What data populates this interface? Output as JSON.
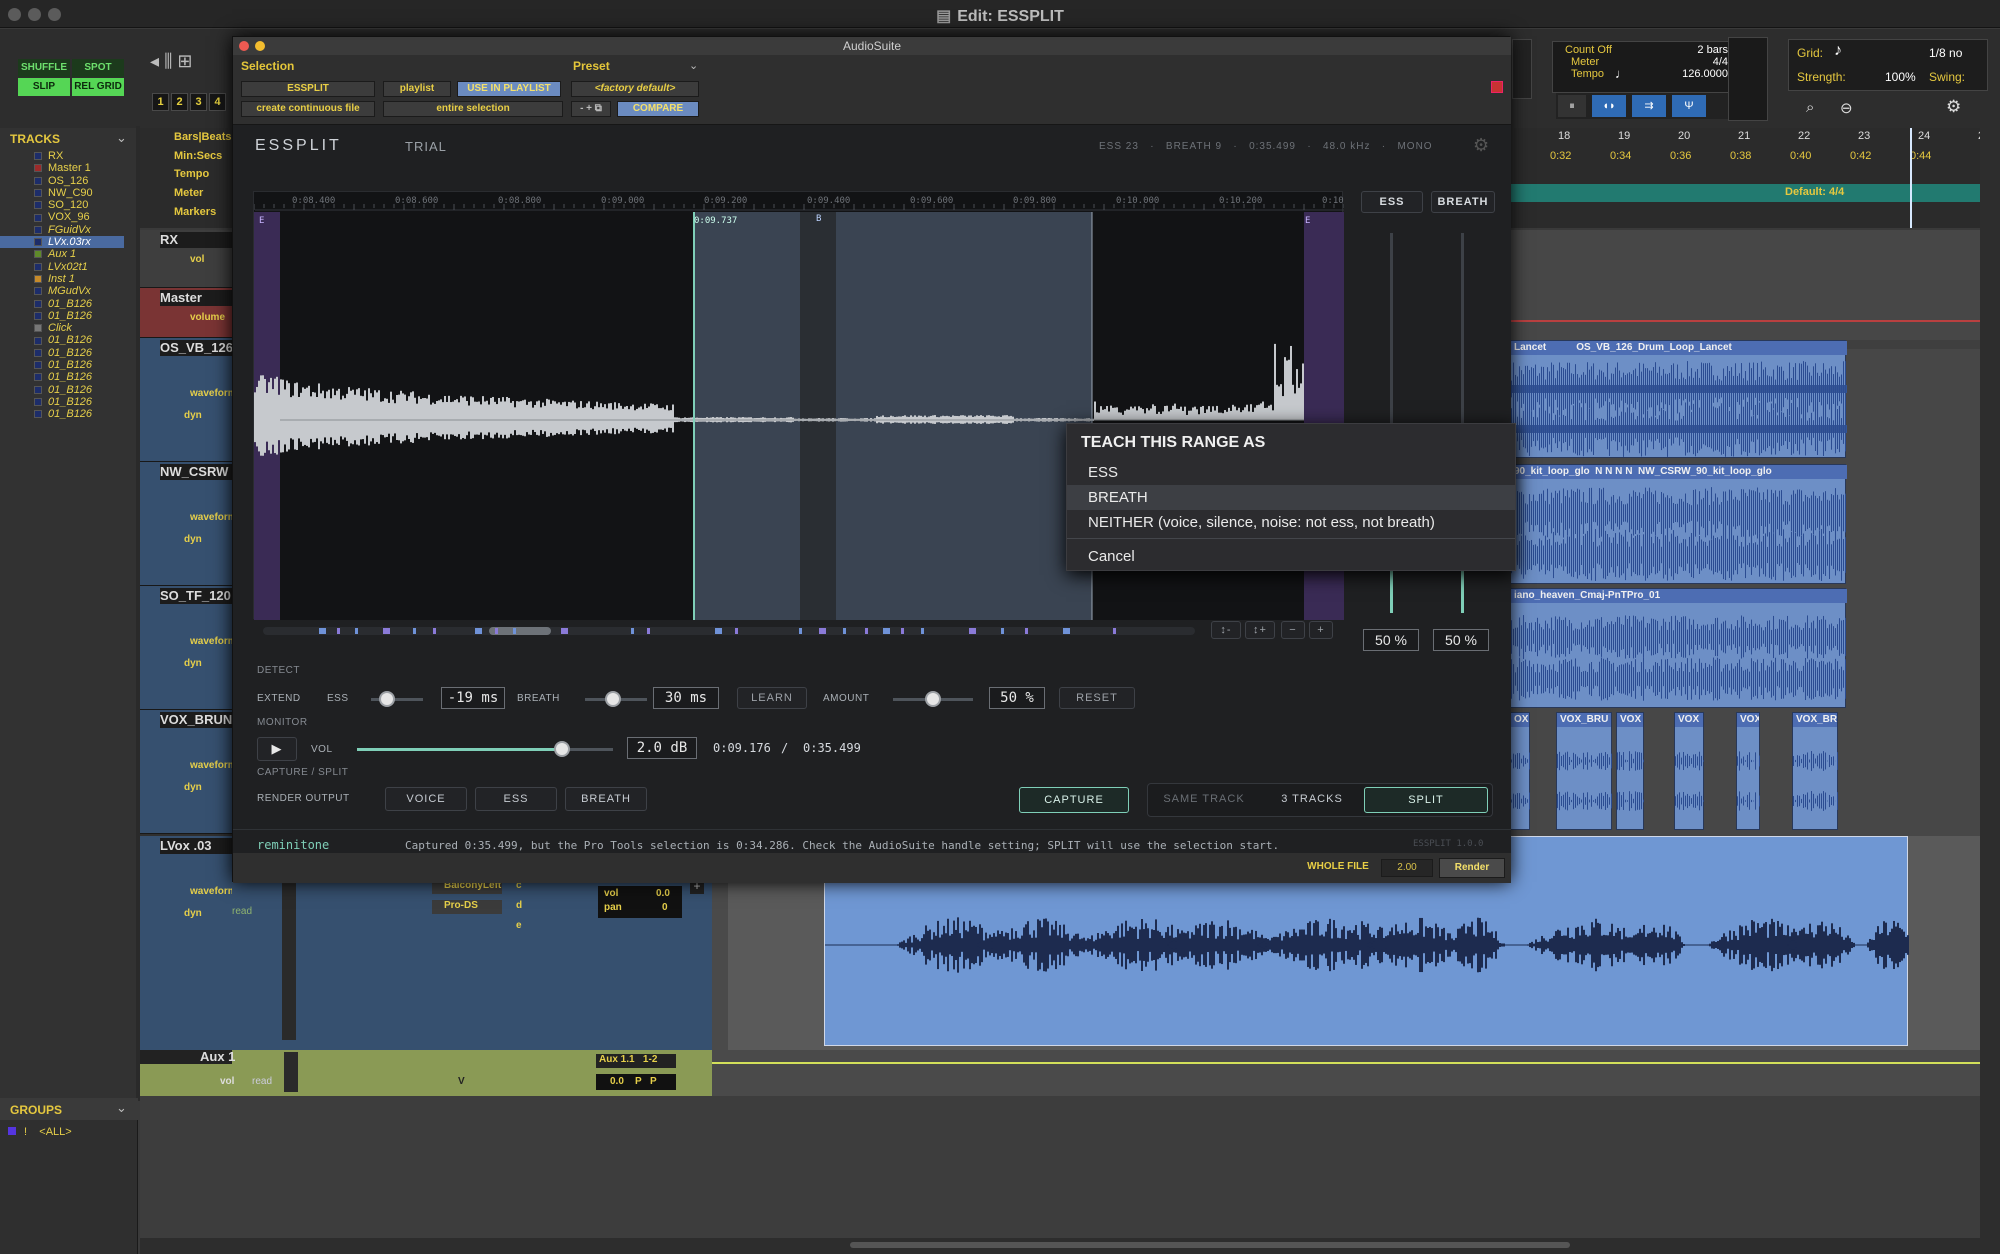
{
  "window": {
    "title": "Edit: ESSPLIT"
  },
  "toolbar": {
    "shuffle": "SHUFFLE",
    "spot": "SPOT",
    "slip": "SLIP",
    "relgrid": "REL GRID",
    "zoom_presets": [
      "1",
      "2",
      "3",
      "4"
    ],
    "count_off": "Count Off",
    "meter": "Meter",
    "tempo": "Tempo",
    "count_bars": "2 bars",
    "meter_val": "4/4",
    "tempo_val": "126.0000",
    "grid": "Grid:",
    "grid_val": "1/8 no",
    "strength": "Strength:",
    "strength_val": "100%",
    "swing": "Swing:"
  },
  "tracks_panel": {
    "title": "TRACKS",
    "items": [
      {
        "name": "RX",
        "color": "#e6cf4a"
      },
      {
        "name": "Master 1",
        "color": "#e6cf4a"
      },
      {
        "name": "OS_126",
        "color": "#e6cf4a"
      },
      {
        "name": "NW_C90",
        "color": "#e6cf4a"
      },
      {
        "name": "SO_120",
        "color": "#e6cf4a"
      },
      {
        "name": "VOX_96",
        "color": "#e6cf4a"
      },
      {
        "name": "FGuidVx",
        "color": "#e6cf4a"
      },
      {
        "name": "LVx.03rx",
        "color": "#ffffff"
      },
      {
        "name": "Aux 1",
        "color": "#e6cf4a"
      },
      {
        "name": "LVx02t1",
        "color": "#e6cf4a"
      },
      {
        "name": "Inst 1",
        "color": "#e6cf4a"
      },
      {
        "name": "MGudVx",
        "color": "#e6cf4a"
      },
      {
        "name": "01_B126",
        "color": "#e6cf4a"
      },
      {
        "name": "01_B126",
        "color": "#e6cf4a"
      },
      {
        "name": "Click",
        "color": "#e6cf4a"
      },
      {
        "name": "01_B126",
        "color": "#e6cf4a"
      },
      {
        "name": "01_B126",
        "color": "#e6cf4a"
      },
      {
        "name": "01_B126",
        "color": "#e6cf4a"
      },
      {
        "name": "01_B126",
        "color": "#e6cf4a"
      },
      {
        "name": "01_B126",
        "color": "#e6cf4a"
      },
      {
        "name": "01_B126",
        "color": "#e6cf4a"
      },
      {
        "name": "01_B126",
        "color": "#e6cf4a"
      }
    ]
  },
  "groups_panel": {
    "title": "GROUPS",
    "all": "<ALL>"
  },
  "rulers": [
    "Bars|Beats",
    "Min:Secs",
    "Tempo",
    "Meter",
    "Markers"
  ],
  "timeline": {
    "bars": [
      "18",
      "19",
      "20",
      "21",
      "22",
      "23",
      "24",
      "2"
    ],
    "times": [
      "0:32",
      "0:34",
      "0:36",
      "0:38",
      "0:40",
      "0:42",
      "0:44"
    ],
    "meter_marker": "Default: 4/4"
  },
  "mix_tracks": [
    {
      "name": "RX",
      "view": "vol"
    },
    {
      "name": "Master",
      "view": "volume"
    },
    {
      "name": "OS_VB_126",
      "view": "waveform",
      "dyn": "dyn"
    },
    {
      "name": "NW_CSRW",
      "view": "waveform",
      "dyn": "dyn"
    },
    {
      "name": "SO_TF_120",
      "view": "waveform",
      "dyn": "dyn"
    },
    {
      "name": "VOX_BRUN",
      "view": "waveform",
      "dyn": "dyn"
    },
    {
      "name": "LVox .03",
      "view": "waveform",
      "dyn": "dyn",
      "read": "read"
    },
    {
      "name": "Aux 1",
      "view": "vol",
      "read": "read"
    }
  ],
  "mix_strip": {
    "insert1": "BalconyLeft",
    "insert2": "Pro-DS",
    "vol_lbl": "vol",
    "vol_val": "0.0",
    "pan_lbl": "pan",
    "pan_val": "0",
    "send_c": "c",
    "send_d": "d",
    "send_e": "e",
    "aux_io": "Aux 1.1",
    "aux_out": "1-2",
    "aux_vol": "0.0",
    "p1": "P",
    "p2": "P",
    "v": "V"
  },
  "clips": {
    "os": [
      "Lancet",
      "OS_VB_126_Drum_Loop_Lancet"
    ],
    "nw": [
      "90_kit_loop_glo",
      "N",
      "N",
      "N",
      "N",
      "NW_CSRW_90_kit_loop_glo"
    ],
    "so": [
      "iano_heaven_Cmaj-PnTPro_01"
    ],
    "vox": [
      "OX",
      "VOX_BRU",
      "VOX",
      "VOX",
      "VOX",
      "VOX_BR"
    ]
  },
  "audiosuite": {
    "title": "AudioSuite",
    "selection": "Selection",
    "plugin_dd": "ESSPLIT",
    "playlist_dd": "playlist",
    "use_in_playlist": "USE IN PLAYLIST",
    "create_dd": "create continuous file",
    "entire_dd": "entire selection",
    "preset": "Preset",
    "preset_dd": "<factory default>",
    "compare": "COMPARE",
    "whole_file": "WHOLE FILE",
    "handle_val": "2.00",
    "render": "Render"
  },
  "plugin": {
    "name": "ESSPLIT",
    "trial": "TRIAL",
    "stats": "ESS 23   ·   BREATH 9   ·   0:35.499   ·   48.0 kHz   ·   MONO",
    "ticks": [
      "0:08.400",
      "0:08.600",
      "0:08.800",
      "0:09.000",
      "0:09.200",
      "0:09.400",
      "0:09.600",
      "0:09.800",
      "0:10.000",
      "0:10.200",
      "0:10"
    ],
    "cursor_time": "0:09.737",
    "marker_e1": "E",
    "marker_b": "B",
    "marker_e2": "E",
    "ess_btn": "ESS",
    "breath_btn": "BREATH",
    "ess_pct": "50 %",
    "breath_pct": "50 %",
    "zoom_btns": [
      "↕-",
      "↕+",
      "−",
      "+"
    ],
    "detect": "DETECT",
    "extend": "EXTEND",
    "ess_lbl": "ESS",
    "ess_ms": "-19 ms",
    "breath_lbl": "BREATH",
    "breath_ms": "30 ms",
    "learn": "LEARN",
    "amount": "AMOUNT",
    "amount_pct": "50 %",
    "reset": "RESET",
    "monitor": "MONITOR",
    "vol_lbl": "VOL",
    "vol_db": "2.0 dB",
    "pos": "0:09.176",
    "sep": "/",
    "total": "0:35.499",
    "capture_split": "CAPTURE / SPLIT",
    "render_output": "RENDER OUTPUT",
    "voice": "VOICE",
    "ess": "ESS",
    "breath": "BREATH",
    "capture": "CAPTURE",
    "same_track": "SAME TRACK",
    "three_tracks": "3 TRACKS",
    "split": "SPLIT",
    "brand": "reminitone",
    "status": "Captured 0:35.499, but the Pro Tools selection is 0:34.286. Check the AudioSuite handle setting; SPLIT will use the selection start.",
    "version": "ESSPLIT 1.0.0",
    "ess_slider": 0.3,
    "breath_slider": 0.45,
    "amount_slider": 0.5,
    "vol_slider": 0.8
  },
  "menu": {
    "title": "TEACH THIS RANGE AS",
    "ess": "ESS",
    "breath": "BREATH",
    "neither": "NEITHER  (voice, silence, noise: not ess, not breath)",
    "cancel": "Cancel"
  }
}
